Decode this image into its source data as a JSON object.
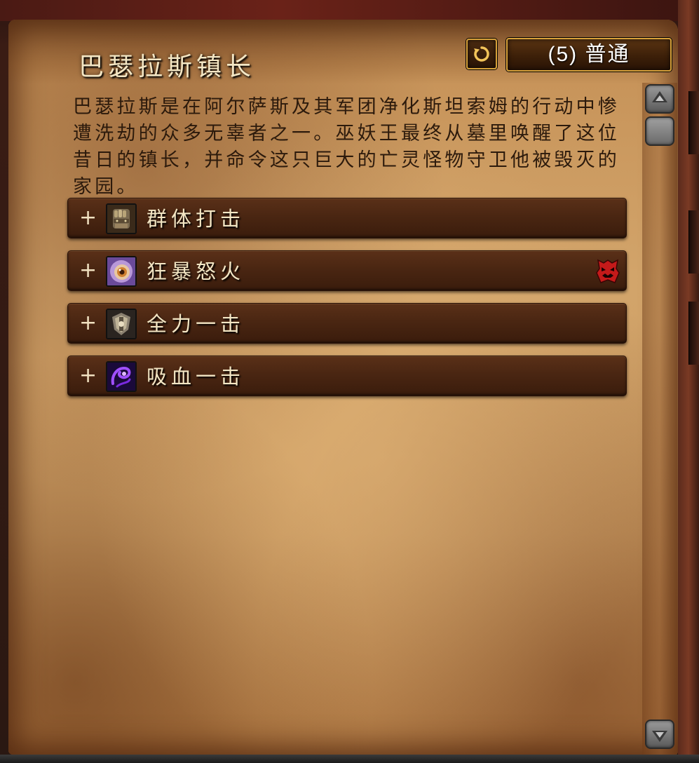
{
  "encounter": {
    "title": "巴瑟拉斯镇长",
    "difficulty_label": "(5) 普通",
    "description": "巴瑟拉斯是在阿尔萨斯及其军团净化斯坦索姆的行动中惨遭洗劫的众多无辜者之一。巫妖王最终从墓里唤醒了这位昔日的镇长，并命令这只巨大的亡灵怪物守卫他被毁灭的家园。"
  },
  "abilities": [
    {
      "name": "群体打击",
      "icon": "armored-fist-icon",
      "expand": "+",
      "flag": ""
    },
    {
      "name": "狂暴怒火",
      "icon": "rage-eye-icon",
      "expand": "+",
      "flag": "enrage-icon"
    },
    {
      "name": "全力一击",
      "icon": "shield-strike-icon",
      "expand": "+",
      "flag": ""
    },
    {
      "name": "吸血一击",
      "icon": "vampiric-strike-icon",
      "expand": "+",
      "flag": ""
    }
  ],
  "icons": {
    "reset": "reset-arrow-icon",
    "scroll_up": "scroll-up-icon",
    "scroll_down": "scroll-down-icon"
  },
  "colors": {
    "title_text": "#f3e6c4",
    "body_text": "#2c1a0c",
    "button_border": "#d8a23a",
    "enrage_red": "#c41a1a"
  }
}
